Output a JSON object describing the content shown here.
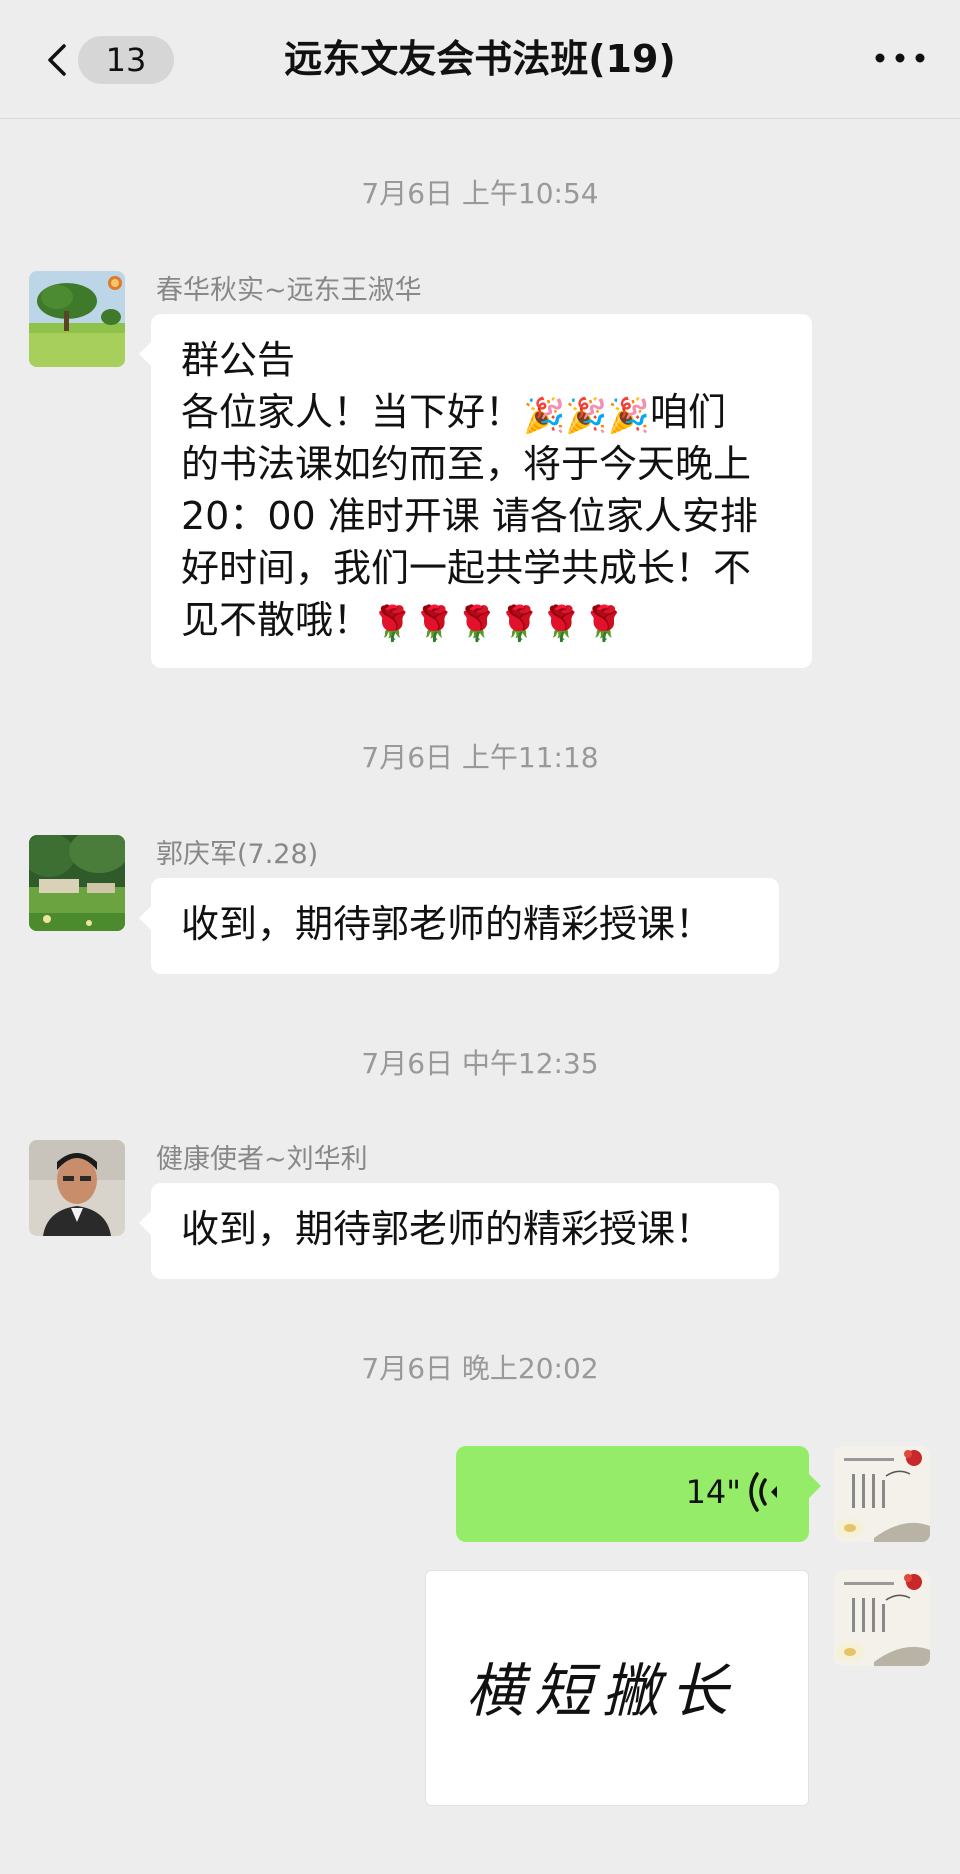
{
  "header": {
    "back_badge": "13",
    "title": "远东文友会书法班(19)"
  },
  "messages": [
    {
      "timestamp": "7月6日 上午10:54",
      "sender": "春华秋实~远东王淑华",
      "lines": [
        "群公告",
        "各位家人！当下好！",
        "的书法课如约而至，将于今天晚上",
        "20：00 准时开课 请各位家人安排",
        "好时间，我们一起共学共成长！不",
        "见不散哦！"
      ],
      "line2_emojis": "🎉🎉🎉",
      "line2_tail": "咱们",
      "line6_emojis": "🌹🌹🌹🌹🌹🌹"
    },
    {
      "timestamp": "7月6日 上午11:18",
      "sender": "郭庆军(7.28)",
      "text": "收到，期待郭老师的精彩授课！"
    },
    {
      "timestamp": "7月6日 中午12:35",
      "sender": "健康使者~刘华利",
      "text": "收到，期待郭老师的精彩授课！"
    },
    {
      "timestamp": "7月6日 晚上20:02",
      "voice_duration": "14\"",
      "image_text": "横短撇长"
    }
  ],
  "colors": {
    "background": "#ededed",
    "bubble_incoming": "#ffffff",
    "bubble_outgoing": "#95ec69",
    "timestamp": "#999999",
    "sender_name": "#888888"
  },
  "icons": {
    "back": "chevron-left-icon",
    "more": "more-horizontal-icon",
    "voice": "voice-wave-icon"
  }
}
